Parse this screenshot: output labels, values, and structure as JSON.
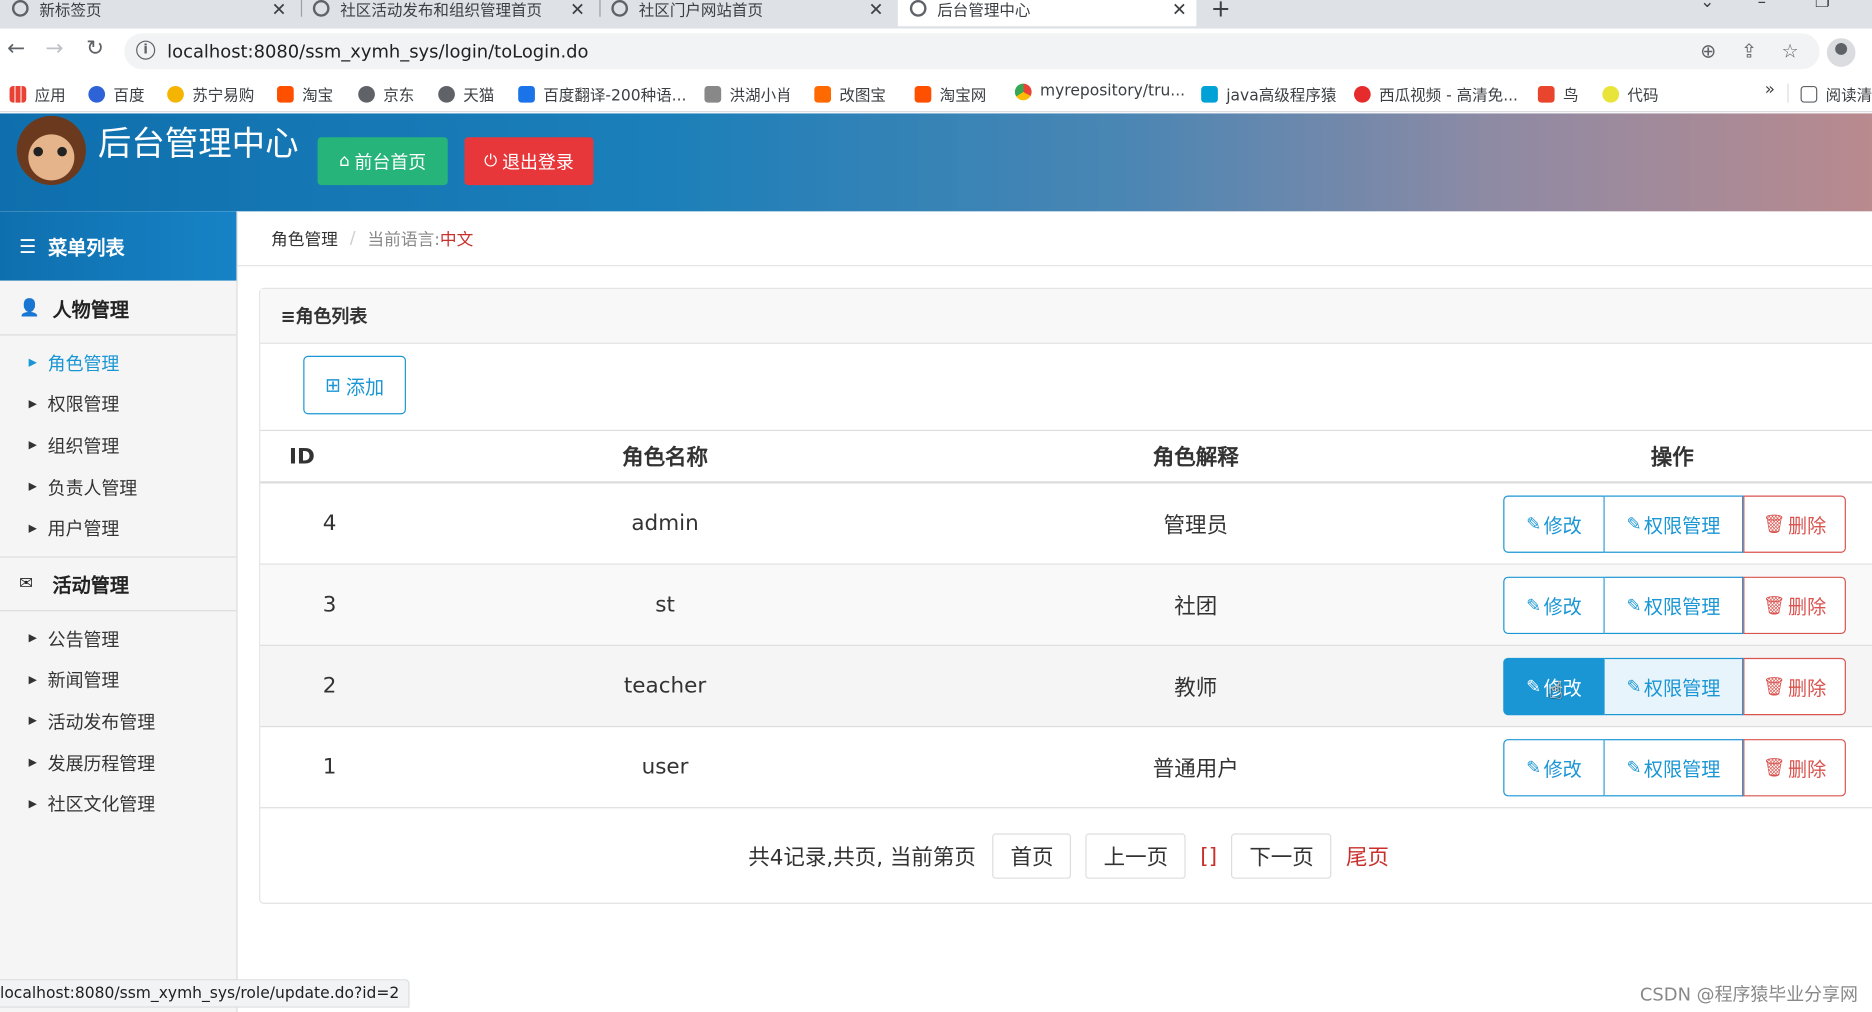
{
  "browser": {
    "tabs": [
      "新标签页",
      "社区活动发布和组织管理首页",
      "社区门户网站首页",
      "后台管理中心"
    ],
    "url": "localhost:8080/ssm_xymh_sys/login/toLogin.do",
    "bookmarks": [
      "应用",
      "百度",
      "苏宁易购",
      "淘宝",
      "京东",
      "天猫",
      "百度翻译-200种语...",
      "洪湖小肖",
      "改图宝",
      "淘宝网",
      "myrepository/tru...",
      "java高级程序猿",
      "西瓜视频 - 高清免...",
      "鸟",
      "代码"
    ],
    "bookmark_more": "»",
    "reading_list": "阅读清",
    "status_url": "localhost:8080/ssm_xymh_sys/role/update.do?id=2"
  },
  "header": {
    "title": "后台管理中心",
    "front_btn": "前台首页",
    "logout_btn": "退出登录"
  },
  "sidebar": {
    "title": "菜单列表",
    "groups": [
      {
        "label": "人物管理",
        "items": [
          "角色管理",
          "权限管理",
          "组织管理",
          "负责人管理",
          "用户管理"
        ]
      },
      {
        "label": "活动管理",
        "items": [
          "公告管理",
          "新闻管理",
          "活动发布管理",
          "发展历程管理",
          "社区文化管理"
        ]
      }
    ]
  },
  "breadcrumb": {
    "page": "角色管理",
    "lang_label": "当前语言:",
    "lang": "中文"
  },
  "panel": {
    "title": "≡角色列表",
    "add_btn": "添加"
  },
  "table": {
    "headers": [
      "ID",
      "角色名称",
      "角色解释",
      "操作"
    ],
    "rows": [
      {
        "id": "4",
        "name": "admin",
        "desc": "管理员"
      },
      {
        "id": "3",
        "name": "st",
        "desc": "社团"
      },
      {
        "id": "2",
        "name": "teacher",
        "desc": "教师"
      },
      {
        "id": "1",
        "name": "user",
        "desc": "普通用户"
      }
    ],
    "op_edit": "修改",
    "op_perm": "权限管理",
    "op_delete": "删除"
  },
  "pager": {
    "info": "共4记录,共页, 当前第页",
    "first": "首页",
    "prev": "上一页",
    "brackets": "[]",
    "next": "下一页",
    "last": "尾页"
  },
  "watermark": "CSDN @程序猿毕业分享网",
  "colors": {
    "primary": "#1a96d4",
    "header_start": "#0f6fae",
    "green_btn": "#26b47a",
    "red_btn": "#e8373b",
    "danger": "#d9534f"
  }
}
